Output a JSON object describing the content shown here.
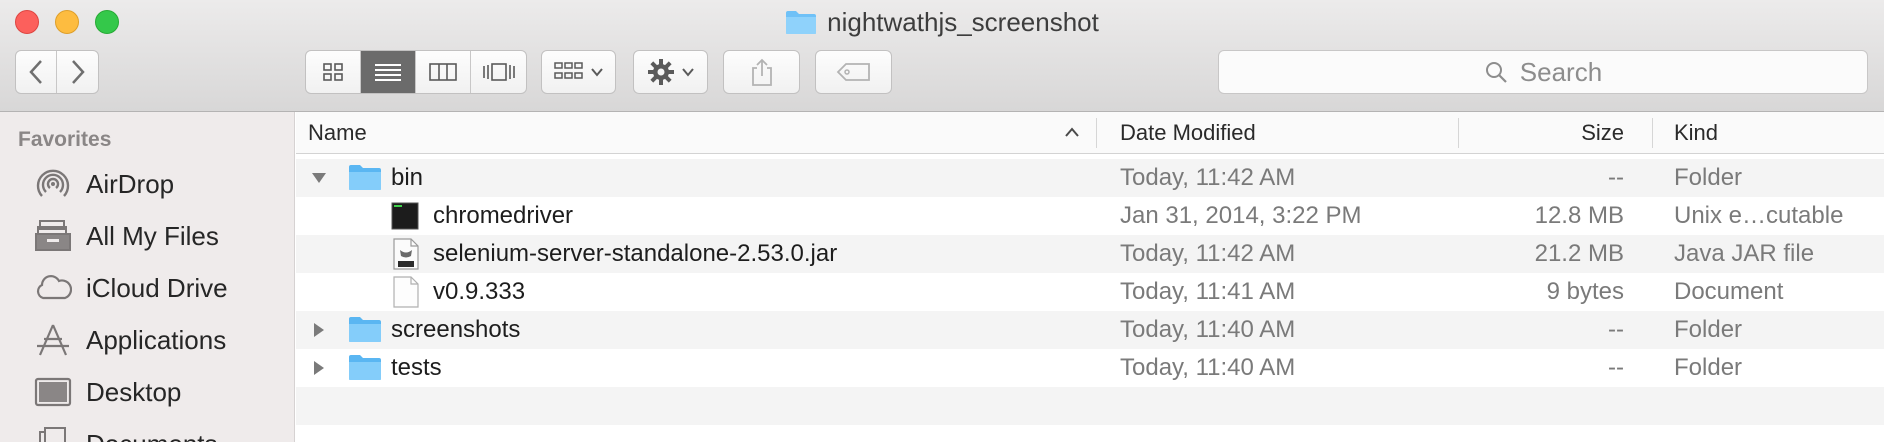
{
  "window": {
    "title": "nightwathjs_screenshot",
    "title_icon": "folder-icon"
  },
  "toolbar": {
    "back_icon": "chevron-left-icon",
    "forward_icon": "chevron-right-icon",
    "view_modes": [
      "icon-view",
      "list-view",
      "column-view",
      "cover-flow-view"
    ],
    "active_view": "list-view",
    "arrange_icon": "arrange-icon",
    "action_icon": "gear-icon",
    "share_icon": "share-icon",
    "tag_icon": "tag-icon",
    "search_placeholder": "Search"
  },
  "sidebar": {
    "heading": "Favorites",
    "items": [
      {
        "label": "AirDrop",
        "icon": "airdrop-icon"
      },
      {
        "label": "All My Files",
        "icon": "all-files-icon"
      },
      {
        "label": "iCloud Drive",
        "icon": "cloud-icon"
      },
      {
        "label": "Applications",
        "icon": "applications-icon"
      },
      {
        "label": "Desktop",
        "icon": "desktop-icon"
      },
      {
        "label": "Documents",
        "icon": "documents-icon"
      }
    ]
  },
  "columns": {
    "name": "Name",
    "date": "Date Modified",
    "size": "Size",
    "kind": "Kind",
    "sort_indicator": "^"
  },
  "rows": [
    {
      "name": "bin",
      "date": "Today, 11:42 AM",
      "size": "--",
      "kind": "Folder",
      "icon": "folder-icon",
      "expanded": true,
      "depth": 0
    },
    {
      "name": "chromedriver",
      "date": "Jan 31, 2014, 3:22 PM",
      "size": "12.8 MB",
      "kind": "Unix e…cutable",
      "icon": "terminal-icon",
      "depth": 1
    },
    {
      "name": "selenium-server-standalone-2.53.0.jar",
      "date": "Today, 11:42 AM",
      "size": "21.2 MB",
      "kind": "Java JAR file",
      "icon": "jar-icon",
      "depth": 1
    },
    {
      "name": "v0.9.333",
      "date": "Today, 11:41 AM",
      "size": "9 bytes",
      "kind": "Document",
      "icon": "document-icon",
      "depth": 1
    },
    {
      "name": "screenshots",
      "date": "Today, 11:40 AM",
      "size": "--",
      "kind": "Folder",
      "icon": "folder-icon",
      "expanded": false,
      "depth": 0
    },
    {
      "name": "tests",
      "date": "Today, 11:40 AM",
      "size": "--",
      "kind": "Folder",
      "icon": "folder-icon",
      "expanded": false,
      "depth": 0
    }
  ]
}
